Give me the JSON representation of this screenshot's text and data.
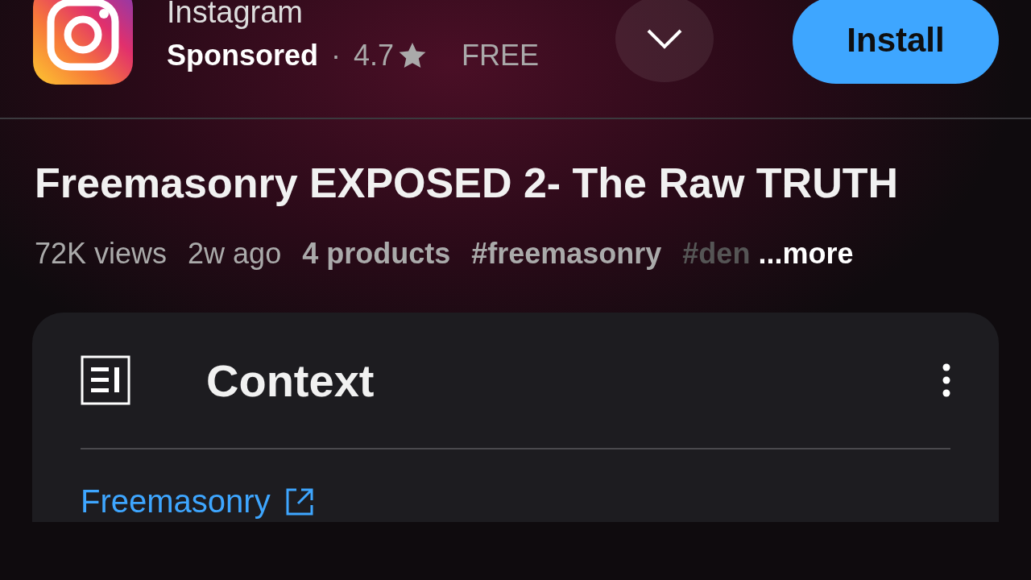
{
  "ad": {
    "app_name": "Instagram",
    "label": "Sponsored",
    "separator": "·",
    "rating": "4.7",
    "price": "FREE",
    "install_button": "Install"
  },
  "video": {
    "title": "Freemasonry EXPOSED 2- The Raw TRUTH",
    "meta": [
      {
        "text": "72K views",
        "kind": "plain"
      },
      {
        "text": "2w ago",
        "kind": "plain"
      },
      {
        "text": "4 products",
        "kind": "bold"
      },
      {
        "text": "#freemasonry",
        "kind": "bold"
      },
      {
        "text": "#den",
        "kind": "faded"
      }
    ],
    "more": "...more"
  },
  "context": {
    "title": "Context",
    "link": "Freemasonry"
  }
}
